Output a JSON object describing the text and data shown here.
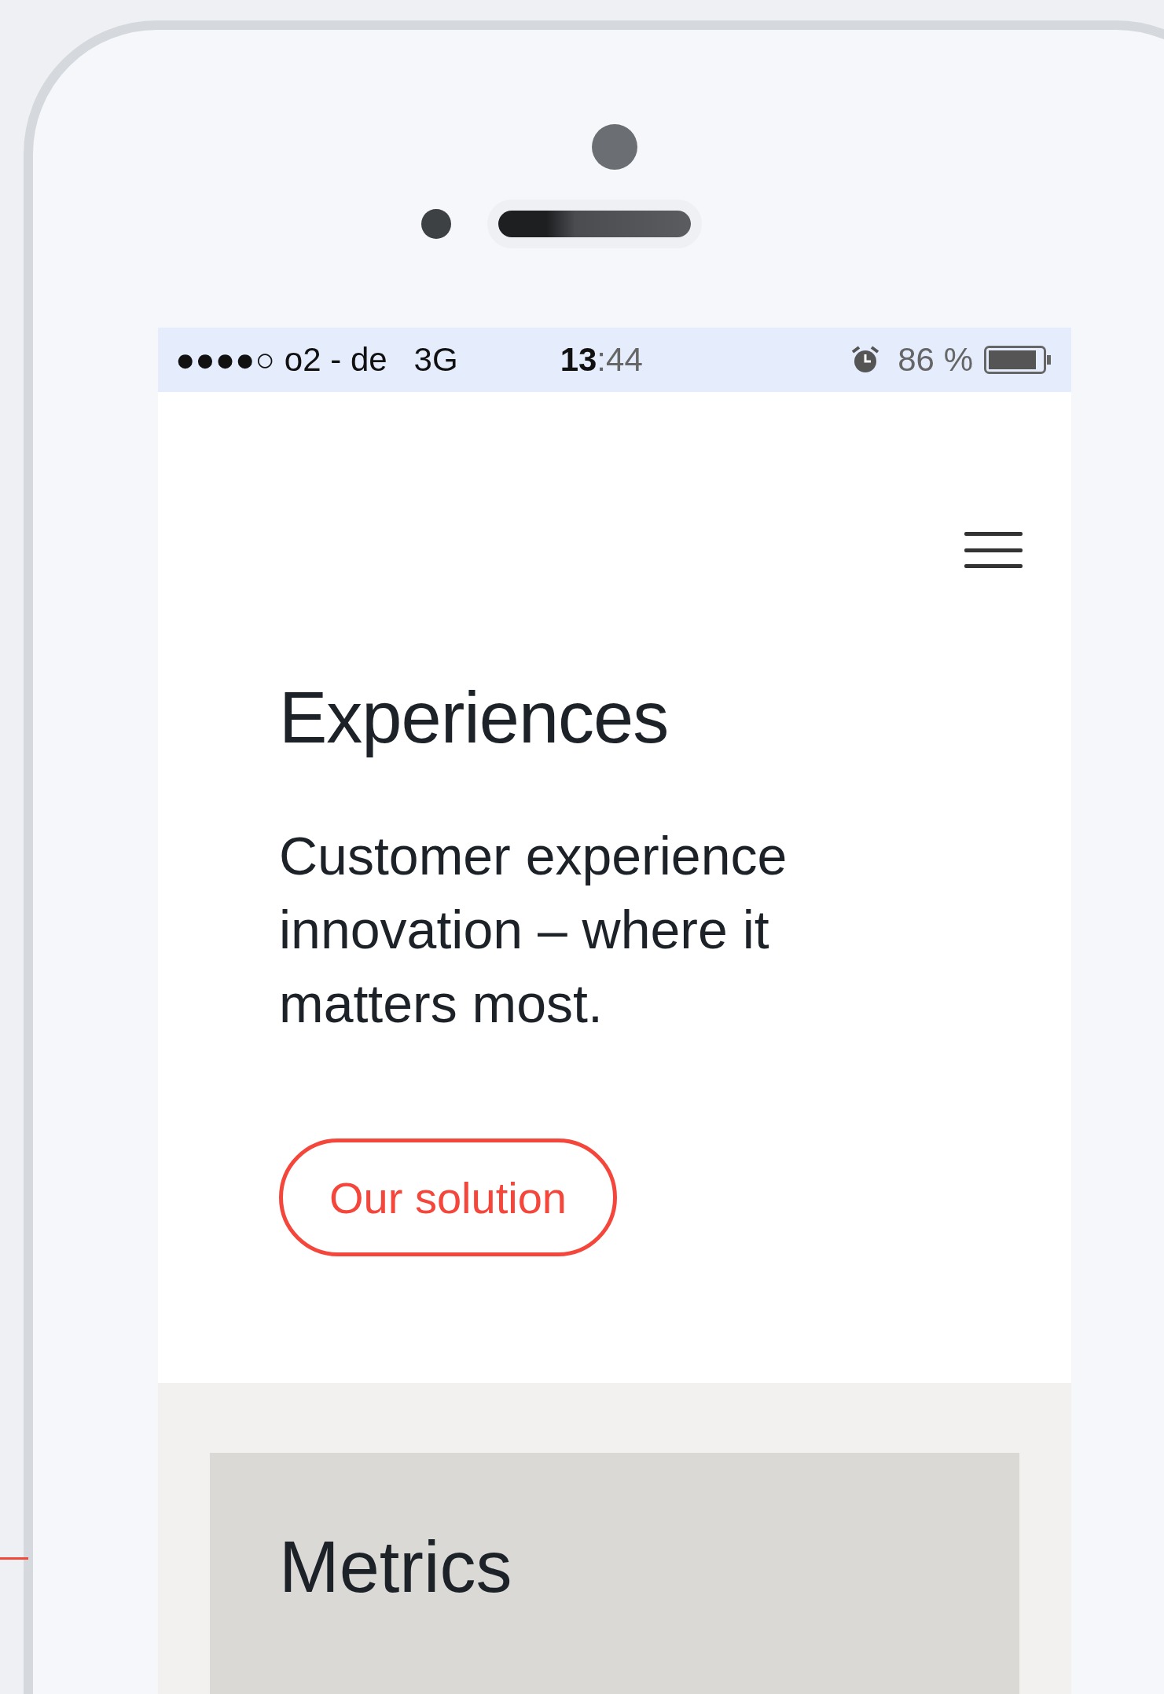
{
  "status_bar": {
    "signal": "●●●●○",
    "carrier": "o2 - de",
    "network": "3G",
    "time": "**13**:44",
    "battery": "86 %"
  },
  "hero": {
    "title": "Experiences",
    "text": "Customer experience innovation – where it matters most.",
    "button": "Our solution"
  },
  "metrics": {
    "title": "Metrics"
  }
}
